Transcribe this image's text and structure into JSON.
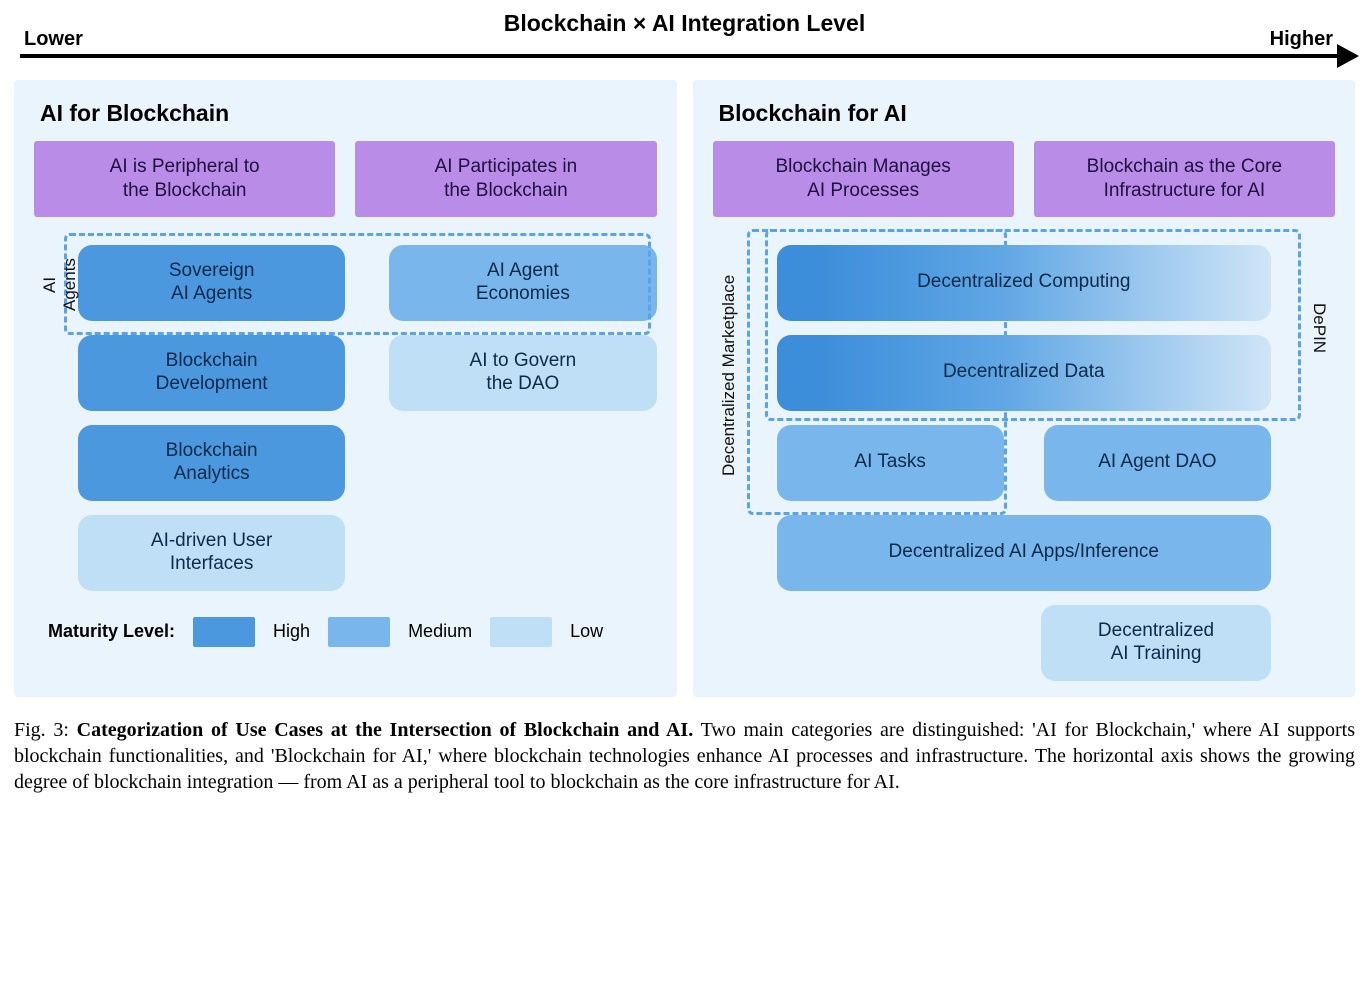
{
  "axis": {
    "title": "Blockchain × AI Integration Level",
    "low": "Lower",
    "high": "Higher"
  },
  "panels": {
    "left": {
      "title": "AI for Blockchain",
      "sub": [
        "AI is Peripheral to\nthe Blockchain",
        "AI Participates in\nthe Blockchain"
      ],
      "group_label": "AI Agents",
      "col1": [
        {
          "label": "Sovereign\nAI Agents",
          "maturity": "high"
        },
        {
          "label": "Blockchain\nDevelopment",
          "maturity": "high"
        },
        {
          "label": "Blockchain\nAnalytics",
          "maturity": "high"
        },
        {
          "label": "AI-driven User\nInterfaces",
          "maturity": "low"
        }
      ],
      "col2": [
        {
          "label": "AI Agent\nEconomies",
          "maturity": "medium"
        },
        {
          "label": "AI to Govern\nthe DAO",
          "maturity": "low"
        }
      ]
    },
    "right": {
      "title": "Blockchain for AI",
      "sub": [
        "Blockchain Manages\nAI Processes",
        "Blockchain as the Core\nInfrastructure for AI"
      ],
      "group_dm": "Decentralized Marketplace",
      "group_depin": "DePIN",
      "rows": {
        "r1": {
          "label": "Decentralized Computing",
          "maturity": "gradient"
        },
        "r2": {
          "label": "Decentralized Data",
          "maturity": "gradient"
        },
        "r3a": {
          "label": "AI Tasks",
          "maturity": "medium"
        },
        "r3b": {
          "label": "AI Agent DAO",
          "maturity": "medium"
        },
        "r4": {
          "label": "Decentralized AI Apps/Inference",
          "maturity": "medium"
        },
        "r5": {
          "label": "Decentralized\nAI Training",
          "maturity": "low"
        }
      }
    }
  },
  "legend": {
    "title": "Maturity Level:",
    "high": "High",
    "medium": "Medium",
    "low": "Low"
  },
  "caption": {
    "fig": "Fig. 3:",
    "bold": "Categorization of Use Cases at the Intersection of Blockchain and AI.",
    "rest": " Two main categories are distinguished: 'AI for Blockchain,' where AI supports blockchain functionalities, and 'Blockchain for AI,' where blockchain technologies enhance AI processes and infrastructure. The horizontal axis shows the growing degree of blockchain integration — from AI as a peripheral tool to blockchain as the core infrastructure for AI."
  },
  "colors": {
    "high": "#4b98df",
    "medium": "#78b6eb",
    "low": "#bfdff6",
    "sub": "#b98ce8",
    "panel": "#e9f4fc"
  },
  "chart_data": {
    "type": "table",
    "title": "Blockchain × AI Integration Level — Categorization of Use Cases",
    "integration_axis": {
      "low_end": "Lower",
      "high_end": "Higher"
    },
    "maturity_levels": [
      "High",
      "Medium",
      "Low",
      "Gradient (High→Low across integration)"
    ],
    "categories": [
      {
        "name": "AI for Blockchain",
        "subcategories": [
          {
            "name": "AI is Peripheral to the Blockchain",
            "integration_rank": 1,
            "use_cases": [
              {
                "name": "Sovereign AI Agents",
                "maturity": "High",
                "groups": [
                  "AI Agents"
                ]
              },
              {
                "name": "Blockchain Development",
                "maturity": "High"
              },
              {
                "name": "Blockchain Analytics",
                "maturity": "High"
              },
              {
                "name": "AI-driven User Interfaces",
                "maturity": "Low"
              }
            ]
          },
          {
            "name": "AI Participates in the Blockchain",
            "integration_rank": 2,
            "use_cases": [
              {
                "name": "AI Agent Economies",
                "maturity": "Medium",
                "groups": [
                  "AI Agents"
                ]
              },
              {
                "name": "AI to Govern the DAO",
                "maturity": "Low"
              }
            ]
          }
        ]
      },
      {
        "name": "Blockchain for AI",
        "subcategories": [
          {
            "name": "Blockchain Manages AI Processes",
            "integration_rank": 3,
            "use_cases": [
              {
                "name": "Decentralized Computing",
                "maturity": "Gradient",
                "groups": [
                  "Decentralized Marketplace",
                  "DePIN"
                ],
                "spans_to_rank": 4
              },
              {
                "name": "Decentralized Data",
                "maturity": "Gradient",
                "groups": [
                  "Decentralized Marketplace",
                  "DePIN"
                ],
                "spans_to_rank": 4
              },
              {
                "name": "AI Tasks",
                "maturity": "Medium",
                "groups": [
                  "Decentralized Marketplace"
                ]
              },
              {
                "name": "Decentralized AI Apps/Inference",
                "maturity": "Medium",
                "spans_to_rank": 4
              }
            ]
          },
          {
            "name": "Blockchain as the Core Infrastructure for AI",
            "integration_rank": 4,
            "use_cases": [
              {
                "name": "AI Agent DAO",
                "maturity": "Medium"
              },
              {
                "name": "Decentralized AI Training",
                "maturity": "Low"
              }
            ]
          }
        ]
      }
    ]
  }
}
